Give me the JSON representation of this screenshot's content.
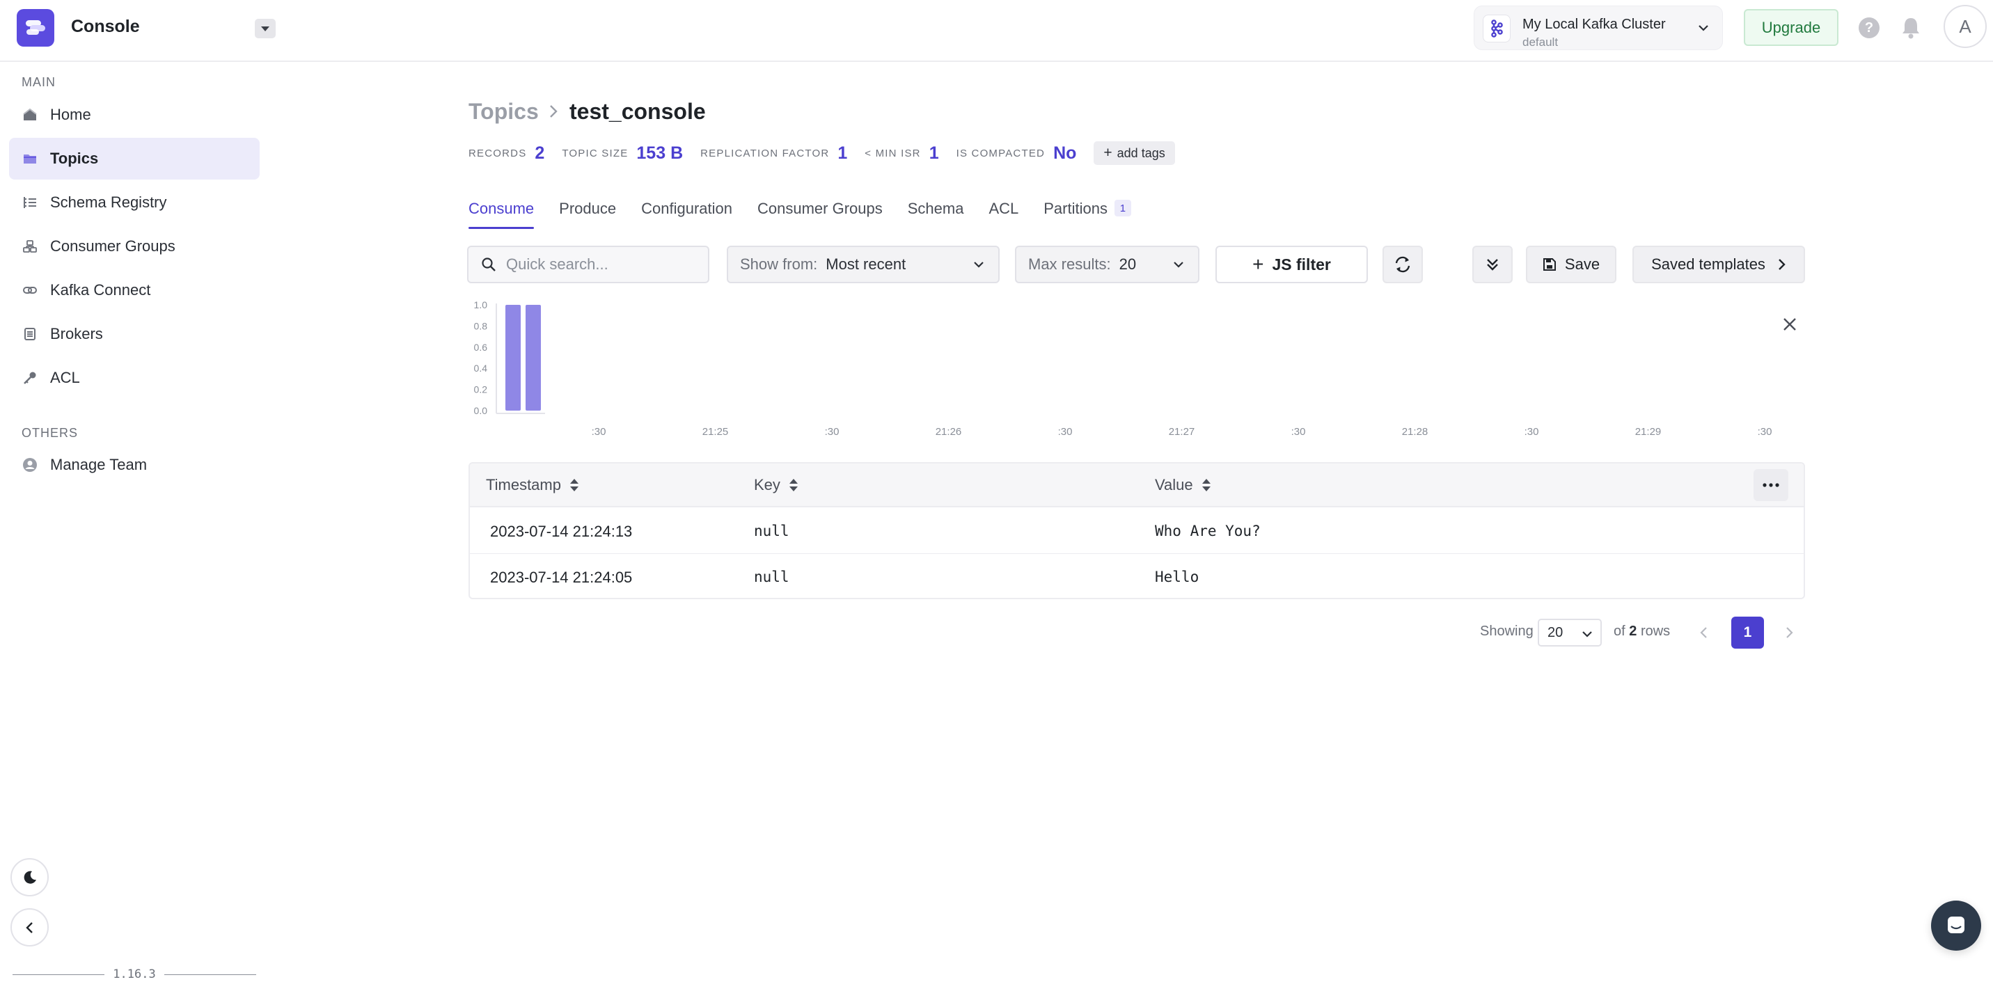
{
  "app": {
    "title": "Console"
  },
  "cluster": {
    "name": "My Local Kafka Cluster",
    "env": "default"
  },
  "header": {
    "upgrade_label": "Upgrade",
    "help_label": "?",
    "avatar_initial": "A"
  },
  "sidebar": {
    "sections": [
      {
        "label": "MAIN"
      },
      {
        "label": "OTHERS"
      }
    ],
    "items": [
      {
        "label": "Home",
        "icon": "home-icon"
      },
      {
        "label": "Topics",
        "icon": "topics-icon",
        "active": true
      },
      {
        "label": "Schema Registry",
        "icon": "schema-registry-icon"
      },
      {
        "label": "Consumer Groups",
        "icon": "consumer-groups-icon"
      },
      {
        "label": "Kafka Connect",
        "icon": "kafka-connect-icon"
      },
      {
        "label": "Brokers",
        "icon": "brokers-icon"
      },
      {
        "label": "ACL",
        "icon": "key-icon"
      },
      {
        "label": "Manage Team",
        "icon": "user-icon"
      }
    ],
    "version": "1.16.3"
  },
  "breadcrumb": {
    "parent": "Topics",
    "current": "test_console"
  },
  "stats": [
    {
      "label": "RECORDS",
      "value": "2"
    },
    {
      "label": "TOPIC SIZE",
      "value": "153 B"
    },
    {
      "label": "REPLICATION FACTOR",
      "value": "1"
    },
    {
      "label": "< MIN ISR",
      "value": "1"
    },
    {
      "label": "IS COMPACTED",
      "value": "No"
    }
  ],
  "add_tags_label": "add tags",
  "tabs": [
    {
      "label": "Consume",
      "active": true
    },
    {
      "label": "Produce"
    },
    {
      "label": "Configuration"
    },
    {
      "label": "Consumer Groups"
    },
    {
      "label": "Schema"
    },
    {
      "label": "ACL"
    },
    {
      "label": "Partitions",
      "badge": "1"
    }
  ],
  "toolbar": {
    "search_placeholder": "Quick search...",
    "show_from_label": "Show from:",
    "show_from_value": "Most recent",
    "max_results_label": "Max results:",
    "max_results_value": "20",
    "js_filter_label": "JS filter",
    "save_label": "Save",
    "saved_templates_label": "Saved templates"
  },
  "chart_data": {
    "type": "bar",
    "ylim": [
      0,
      1.0
    ],
    "yticks": [
      "0.0",
      "0.2",
      "0.4",
      "0.6",
      "0.8",
      "1.0"
    ],
    "xticks": [
      ":30",
      "21:25",
      ":30",
      "21:26",
      ":30",
      "21:27",
      ":30",
      "21:28",
      ":30",
      "21:29",
      ":30"
    ],
    "values": [
      1,
      1
    ],
    "color": "#8f87e6",
    "grid": false
  },
  "table": {
    "columns": [
      "Timestamp",
      "Key",
      "Value"
    ],
    "rows": [
      {
        "timestamp": "2023-07-14 21:24:13",
        "key": "null",
        "value": "Who Are You?"
      },
      {
        "timestamp": "2023-07-14 21:24:05",
        "key": "null",
        "value": "Hello"
      }
    ]
  },
  "pagination": {
    "showing_label": "Showing",
    "page_size": "20",
    "of_prefix": "of",
    "total_rows": "2",
    "rows_suffix": "rows",
    "current_page": "1"
  },
  "colors": {
    "accent": "#4b3fcf",
    "logo": "#5b4bdf",
    "bar": "#8f87e6",
    "upgrade": "#217a3e"
  }
}
